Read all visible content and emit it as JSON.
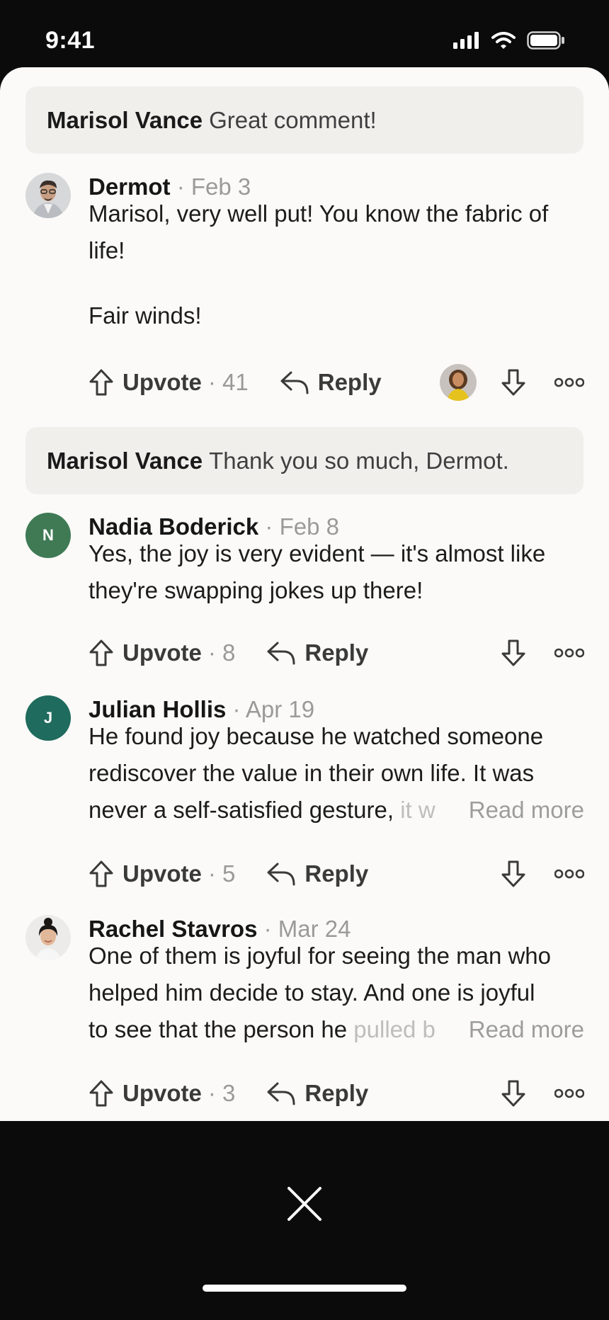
{
  "status_bar": {
    "time": "9:41"
  },
  "quotes": [
    {
      "author": "Marisol Vance",
      "text": "Great comment!"
    },
    {
      "author": "Marisol Vance",
      "text": "Thank you so much, Dermot."
    }
  ],
  "comments": [
    {
      "name": "Dermot",
      "date": "Feb 3",
      "lines": [
        "Marisol, very well put! You know the fabric of",
        "life!"
      ],
      "line_after_gap": "Fair winds!",
      "upvote_label": "Upvote",
      "upvote_count": "41",
      "reply_label": "Reply"
    },
    {
      "name": "Nadia Boderick",
      "date": "Feb 8",
      "initial": "N",
      "avatar_color": "#3f7a55",
      "lines": [
        "Yes, the joy is very evident — it's almost like",
        "they're swapping jokes up there!"
      ],
      "upvote_label": "Upvote",
      "upvote_count": "8",
      "reply_label": "Reply"
    },
    {
      "name": "Julian Hollis",
      "date": "Apr 19",
      "initial": "J",
      "avatar_color": "#1f6b5d",
      "lines": [
        "He found joy because he watched someone",
        "rediscover the value in their own life. It was"
      ],
      "last_line": "never a self-satisfied gesture,",
      "last_line_fade": " it w",
      "read_more": "Read more",
      "upvote_label": "Upvote",
      "upvote_count": "5",
      "reply_label": "Reply"
    },
    {
      "name": "Rachel Stavros",
      "date": "Mar 24",
      "lines": [
        "One of them is joyful for seeing the man who",
        "helped him decide to stay. And one is joyful"
      ],
      "last_line": "to see that the person he",
      "last_line_fade": " pulled b",
      "read_more": "Read more",
      "upvote_label": "Upvote",
      "upvote_count": "3",
      "reply_label": "Reply"
    }
  ],
  "colors": {
    "sheet_bg": "#fbfaf8",
    "quote_bg": "#f0efec",
    "muted": "#9a9a9a"
  },
  "icons": [
    "upvote-arrow-icon",
    "reply-icon",
    "downvote-arrow-icon",
    "more-options-icon",
    "close-icon",
    "cellular-signal-icon",
    "wifi-icon",
    "battery-icon"
  ]
}
